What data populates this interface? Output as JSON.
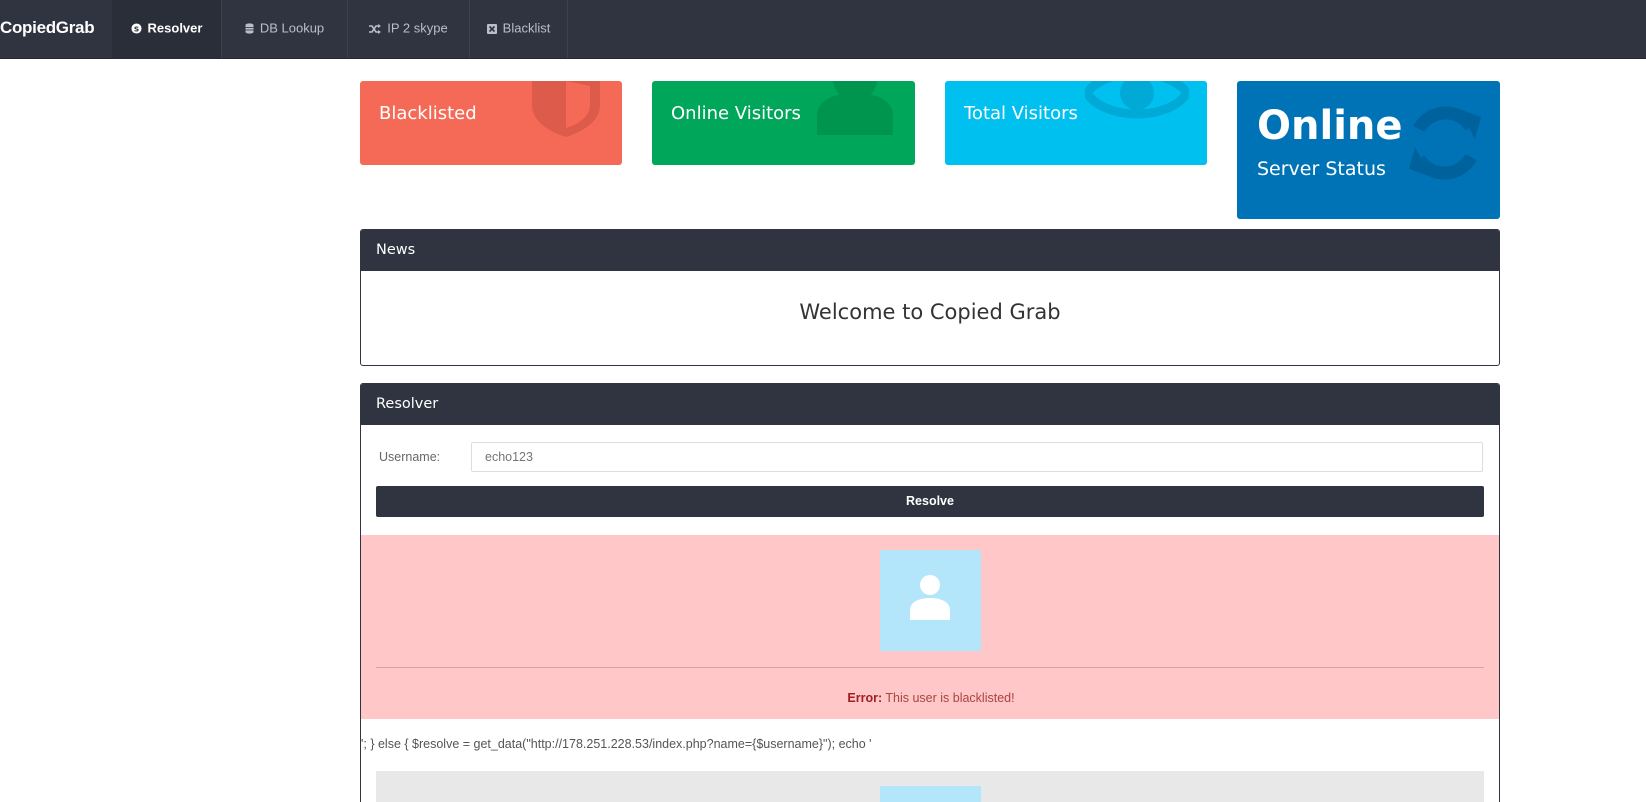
{
  "nav": {
    "brand": "CopiedGrab",
    "items": [
      {
        "label": "Resolver",
        "icon": "skype-icon",
        "active": true
      },
      {
        "label": "DB Lookup",
        "icon": "database-icon",
        "active": false
      },
      {
        "label": "IP 2 skype",
        "icon": "shuffle-icon",
        "active": false
      },
      {
        "label": "Blacklist",
        "icon": "x-square-icon",
        "active": false
      }
    ]
  },
  "tiles": {
    "blacklisted": {
      "title": "Blacklisted",
      "color": "#f56a57",
      "icon": "shield-icon"
    },
    "online_visitors": {
      "title": "Online Visitors",
      "color": "#00a65a",
      "icon": "user-icon"
    },
    "total_visitors": {
      "title": "Total Visitors",
      "color": "#00c0ef",
      "icon": "eye-icon"
    },
    "server_status": {
      "value": "Online",
      "label": "Server Status",
      "color": "#0073b7",
      "icon": "refresh-icon"
    }
  },
  "news": {
    "heading": "News",
    "message": "Welcome to Copied Grab"
  },
  "resolver": {
    "heading": "Resolver",
    "username_label": "Username:",
    "username_placeholder": "echo123",
    "button_label": "Resolve",
    "error_prefix": "Error:",
    "error_text": " This user is blacklisted!",
    "code_leak": "'; } else { $resolve = get_data(\"http://178.251.228.53/index.php?name={$username}\"); echo '"
  },
  "colors": {
    "navbar": "#2f3440",
    "error_bg": "#ffc7c7",
    "avatar_bg": "#b3e5fb"
  }
}
